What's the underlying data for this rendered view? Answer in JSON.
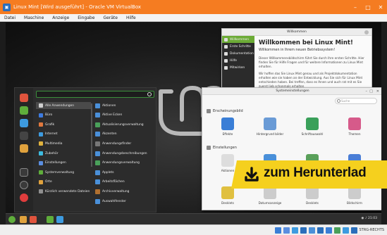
{
  "vbox": {
    "title": "Linux Mint [Wird ausgeführt] - Oracle VM VirtualBox",
    "menu": [
      "Datei",
      "Maschine",
      "Anzeige",
      "Eingabe",
      "Geräte",
      "Hilfe"
    ],
    "host_key": "STRG-RECHTS"
  },
  "start_menu": {
    "categories": [
      {
        "label": "Alle Anwendungen",
        "color": "#cfcfcf"
      },
      {
        "label": "Büro",
        "color": "#3d7be0"
      },
      {
        "label": "Grafik",
        "color": "#e0783d"
      },
      {
        "label": "Internet",
        "color": "#3d9be0"
      },
      {
        "label": "Multimedia",
        "color": "#e0b23d"
      },
      {
        "label": "Zubehör",
        "color": "#3dbbe0"
      },
      {
        "label": "Einstellungen",
        "color": "#5a8ee0"
      },
      {
        "label": "Systemverwaltung",
        "color": "#5fae3b"
      },
      {
        "label": "Orte",
        "color": "#e0a23d"
      },
      {
        "label": "Kürzlich verwendete Dateien",
        "color": "#8f8f8f"
      }
    ],
    "apps": [
      {
        "label": "Aktionen",
        "color": "#4a90d9"
      },
      {
        "label": "Aktive Ecken",
        "color": "#4a90d9"
      },
      {
        "label": "Aktualisierungsverwaltung",
        "color": "#4aa05a"
      },
      {
        "label": "Akzenten",
        "color": "#4a90d9"
      },
      {
        "label": "Anwendungsfinder",
        "color": "#777"
      },
      {
        "label": "Anwendungsbeschreibungen",
        "color": "#4a90d9"
      },
      {
        "label": "Anwendungsverwaltung",
        "color": "#4aa05a"
      },
      {
        "label": "Applets",
        "color": "#4a90d9"
      },
      {
        "label": "Arbeitsflächen",
        "color": "#4a90d9"
      },
      {
        "label": "Archivverwaltung",
        "color": "#b07030"
      },
      {
        "label": "Auswahlfenster",
        "color": "#4a90d9"
      }
    ]
  },
  "welcome": {
    "window_title": "Willkommen",
    "heading": "Willkommen bei Linux Mint!",
    "subheading": "Willkommen in Ihrem neuen Betriebssystem!",
    "nav": [
      "Willkommen",
      "Erste Schritte",
      "Dokumentation",
      "Hilfe",
      "Mitwirken"
    ],
    "para1": "Dieser Willkommensbildschirm führt Sie durch Ihre ersten Schritte. Hier finden Sie für Hilfe Fragen und für weitere Informationen zu Linux Mint erhalten.",
    "para2": "Wir hoffen das Sie Linux Mint genau und als Projektdokumentation erhalten wie sie haben an der Entwicklung. Aus Sie sich für Linux Mint entschieden haben. Bei treffen, dass es Ihnen und auch rat mit es Sie zuerst lieb schonmals erhalten"
  },
  "settings": {
    "window_title": "Systemeinstellungen",
    "search_placeholder": "Suche",
    "section1": "Erscheinungsbild",
    "section2": "Einstellungen",
    "row1": [
      {
        "label": "Effekte",
        "color": "#3a7ed6"
      },
      {
        "label": "Hintergrund bilder",
        "color": "#6a9bd6"
      },
      {
        "label": "Schriftauswahl",
        "color": "#3aa05a"
      },
      {
        "label": "Themen",
        "color": "#d65a8a"
      }
    ],
    "row2": [
      {
        "label": "Aktionen",
        "color": "#ddd"
      },
      {
        "label": "",
        "color": "#4a90d9"
      },
      {
        "label": "",
        "color": "#5aa05a"
      },
      {
        "label": "",
        "color": "#4a7ed6"
      }
    ],
    "row3": [
      {
        "label": "Desklets",
        "color": "#e0c040"
      },
      {
        "label": "Datumsanzeige",
        "color": "#ccc"
      },
      {
        "label": "Desklets",
        "color": "#ccc"
      },
      {
        "label": "Bildschirm",
        "color": "#ccc"
      }
    ]
  },
  "guest_taskbar": {
    "clock": "21:03"
  },
  "banner": {
    "text": "zum Herunterlad",
    "color": "#f5d01e"
  }
}
